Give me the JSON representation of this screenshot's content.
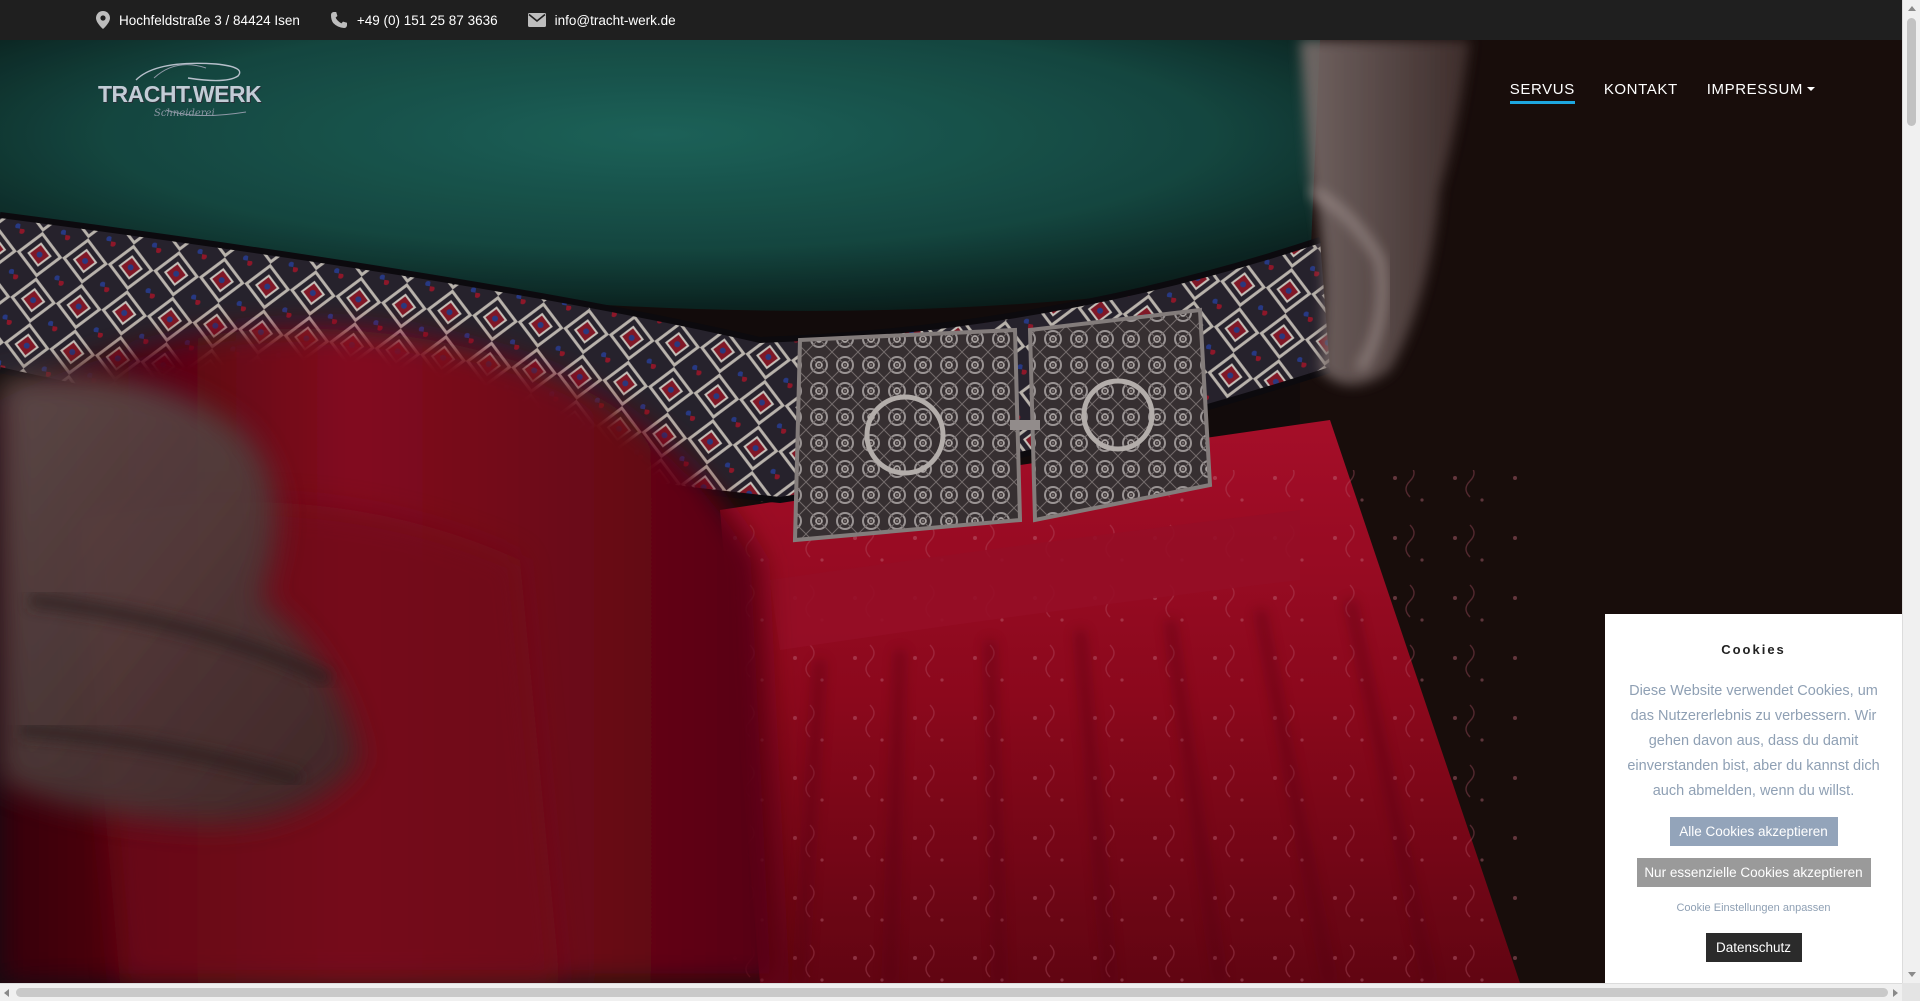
{
  "topbar": {
    "address": "Hochfeldstraße 3 / 84424 Isen",
    "phone": "+49 (0) 151 25 87 3636",
    "email": "info@tracht-werk.de",
    "icons": [
      "map-marker-icon",
      "phone-icon",
      "envelope-icon"
    ]
  },
  "header": {
    "logo_text": "TRACHT.WERK",
    "logo_script": "Schneiderei",
    "nav": [
      {
        "label": "SERVUS",
        "active": true
      },
      {
        "label": "KONTAKT",
        "active": false
      },
      {
        "label": "IMPRESSUM",
        "active": false,
        "dropdown": true
      }
    ]
  },
  "cookie_banner": {
    "title": "Cookies",
    "text": "Diese Website verwendet Cookies, um das Nutzererlebnis zu verbessern. Wir gehen davon aus, dass du damit einverstanden bist, aber du kannst dich auch abmelden, wenn du willst.",
    "accept_all": "Alle Cookies akzeptieren",
    "accept_essential": "Nur essenzielle Cookies akzeptieren",
    "settings_link": "Cookie Einstellungen anpassen",
    "privacy": "Datenschutz"
  },
  "colors": {
    "topbar_bg": "#1f1f1f",
    "nav_active_underline": "#1ea7e0",
    "cookie_text": "#8fa0b4",
    "btn_all_bg": "#93a4ba",
    "btn_essential_bg": "#9a9a9a",
    "btn_privacy_bg": "#2b2b2b"
  }
}
